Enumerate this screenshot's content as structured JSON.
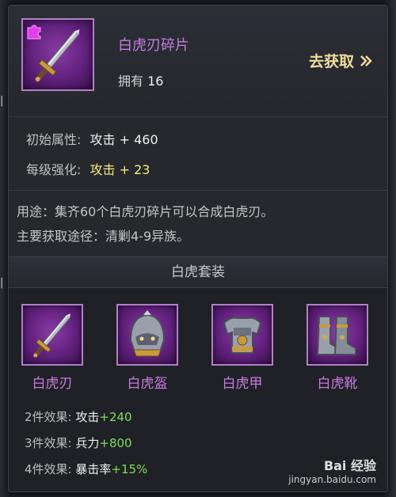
{
  "item": {
    "name": "白虎刃碎片",
    "owned_label": "拥有",
    "owned_count": "16",
    "go_get_label": "去获取"
  },
  "attributes": {
    "base_label": "初始属性:",
    "base_value": "攻击 + 460",
    "level_label": "每级强化:",
    "level_value": "攻击 + 23"
  },
  "description": {
    "line1": "用途：集齐60个白虎刃碎片可以合成白虎刃。",
    "line2": "主要获取途径：清剿4-9异族。"
  },
  "set": {
    "title": "白虎套装",
    "pieces": [
      {
        "label": "白虎刃",
        "icon": "sword-icon"
      },
      {
        "label": "白虎盔",
        "icon": "helmet-icon"
      },
      {
        "label": "白虎甲",
        "icon": "armor-icon"
      },
      {
        "label": "白虎靴",
        "icon": "boots-icon"
      }
    ],
    "effects": [
      {
        "label": "2件效果:",
        "stat": "攻击",
        "bonus": "+240"
      },
      {
        "label": "3件效果:",
        "stat": "兵力",
        "bonus": "+800"
      },
      {
        "label": "4件效果:",
        "stat": "暴击率",
        "bonus": "+15%"
      }
    ]
  },
  "watermark": {
    "logo": "Bai 经验",
    "url": "jingyan.baidu.com"
  },
  "colors": {
    "item_name": "#c77bdf",
    "go_get": "#f2dc9c",
    "upgrade_value": "#f5ec7a",
    "bonus": "#7be05a",
    "frame_purple": "#5c1f78"
  }
}
